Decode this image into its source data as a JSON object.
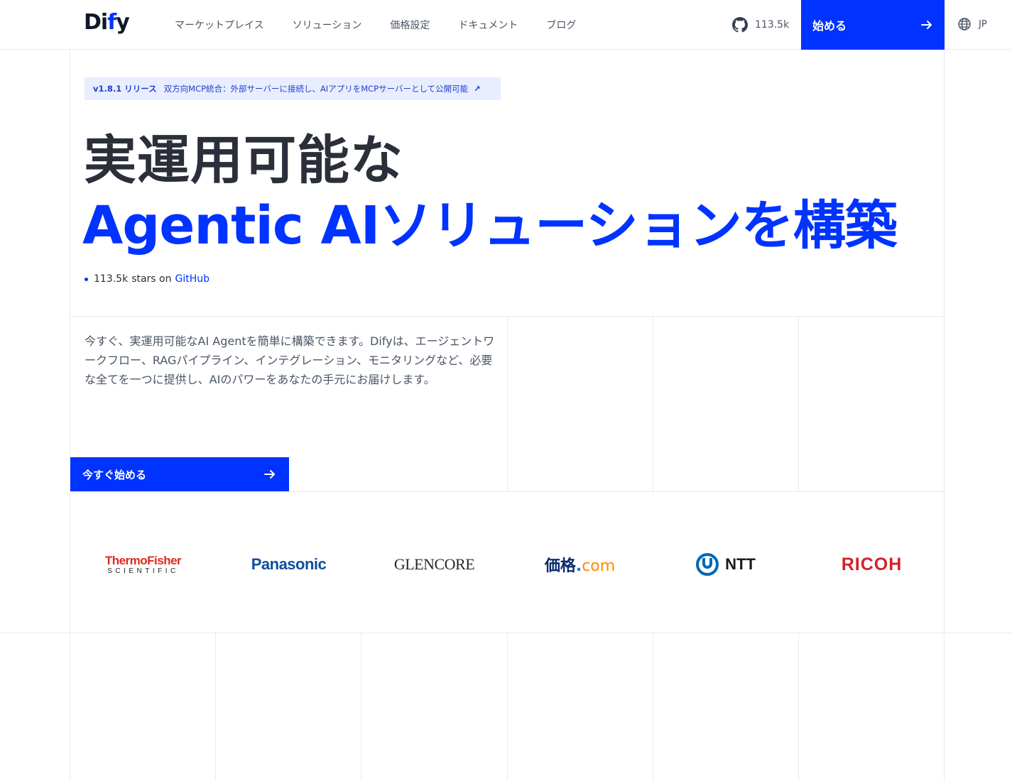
{
  "header": {
    "logo": {
      "text_main": "Di",
      "text_accent": "f",
      "text_end": "y"
    },
    "nav": [
      {
        "label": "マーケットプレイス"
      },
      {
        "label": "ソリューション"
      },
      {
        "label": "価格設定"
      },
      {
        "label": "ドキュメント"
      },
      {
        "label": "ブログ"
      }
    ],
    "github_stars": "113.5k",
    "start_label": "始める",
    "language": "JP"
  },
  "release": {
    "version": "v1.8.1 リリース",
    "text": "双方向MCP統合：外部サーバーに接続し、AIアプリをMCPサーバーとして公開可能",
    "arrow": "↗"
  },
  "hero": {
    "line1": "実運用可能な",
    "line2": "Agentic AIソリューションを構築"
  },
  "stars": {
    "count": "113.5k",
    "text": "stars on",
    "link": "GitHub"
  },
  "description": "今すぐ、実運用可能なAI Agentを簡単に構築できます。Difyは、エージェントワークフロー、RAGパイプライン、インテグレーション、モニタリングなど、必要な全てを一つに提供し、AIのパワーをあなたの手元にお届けします。",
  "cta": {
    "label": "今すぐ始める",
    "arrow": "→"
  },
  "logos": {
    "thermo_line1": "ThermoFisher",
    "thermo_line2": "SCIENTIFIC",
    "panasonic": "Panasonic",
    "glencore": "GLENCORE",
    "kakaku_main": "価格",
    "kakaku_dot": ".",
    "kakaku_com": "com",
    "ntt": "NTT",
    "ricoh": "RICOH"
  },
  "colors": {
    "accent": "#0033ff",
    "grid": "#e6ebf3",
    "release_bg": "#e8eeff"
  }
}
